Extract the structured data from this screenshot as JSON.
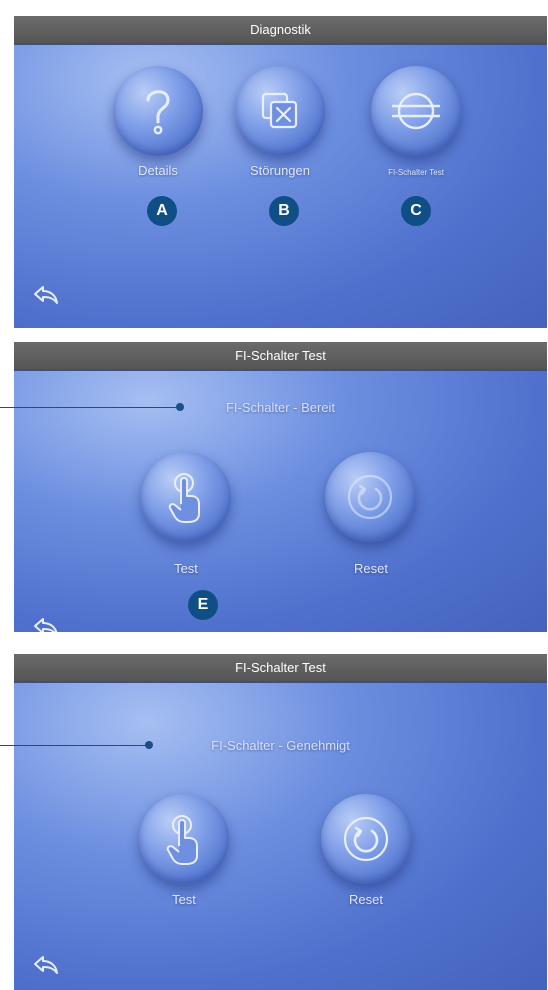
{
  "panels": [
    {
      "title": "Diagnostik",
      "buttons": [
        {
          "label": "Details",
          "icon": "question-mark-icon",
          "marker": "A"
        },
        {
          "label": "Störungen",
          "icon": "fault-box-icon",
          "marker": "B"
        },
        {
          "label": "FI-Schalter Test",
          "icon": "gfci-circle-icon",
          "marker": "C"
        }
      ],
      "back_icon": "back-arrow-icon"
    },
    {
      "title": "FI-Schalter Test",
      "status": "FI-Schalter - Bereit",
      "buttons": [
        {
          "label": "Test",
          "icon": "hand-touch-icon",
          "marker": "E"
        },
        {
          "label": "Reset",
          "icon": "reset-circle-icon"
        }
      ],
      "back_icon": "back-arrow-icon"
    },
    {
      "title": "FI-Schalter Test",
      "status": "FI-Schalter - Genehmigt",
      "buttons": [
        {
          "label": "Test",
          "icon": "hand-touch-icon"
        },
        {
          "label": "Reset",
          "icon": "reset-circle-icon"
        }
      ],
      "back_icon": "back-arrow-icon"
    }
  ],
  "colors": {
    "marker": "#0f4f86",
    "titlebar": "#5e5e5e",
    "panel_blue": "#5b7dd6"
  }
}
